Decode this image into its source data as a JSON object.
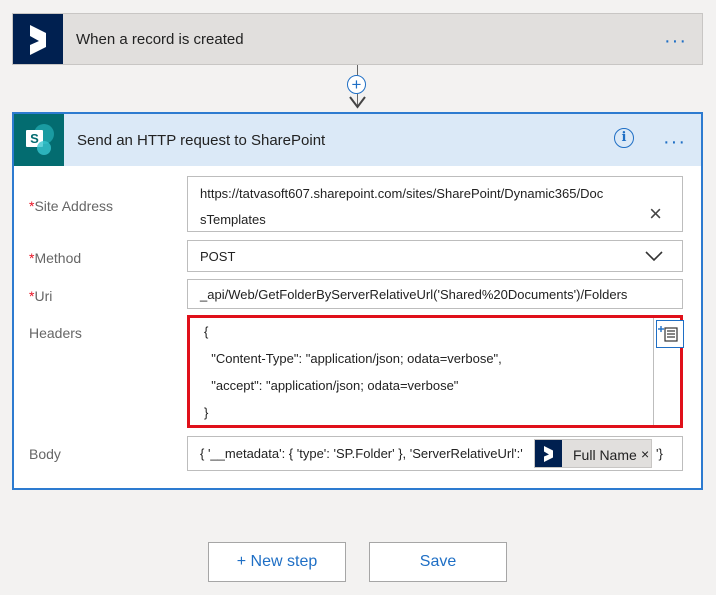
{
  "trigger": {
    "title": "When a record is created",
    "menu": "···"
  },
  "connector": {
    "add_symbol": "+"
  },
  "action": {
    "title": "Send an HTTP request to SharePoint",
    "info_symbol": "i",
    "menu": "···",
    "required_marker": "*",
    "fields": {
      "site_address": {
        "label": "Site Address",
        "value_line1": "https://tatvasoft607.sharepoint.com/sites/SharePoint/Dynamic365/Doc",
        "value_line2": "sTemplates"
      },
      "method": {
        "label": "Method",
        "value": "POST"
      },
      "uri": {
        "label": "Uri",
        "value": "_api/Web/GetFolderByServerRelativeUrl('Shared%20Documents')/Folders"
      },
      "headers": {
        "label": "Headers",
        "lines": [
          "{",
          "  \"Content-Type\": \"application/json; odata=verbose\",",
          "  \"accept\": \"application/json; odata=verbose\"",
          "}"
        ]
      },
      "body": {
        "label": "Body",
        "value": "{ '__metadata': { 'type': 'SP.Folder' }, 'ServerRelativeUrl':'",
        "token_label": "Full Name",
        "token_remove": "×",
        "suffix": "'}"
      }
    }
  },
  "footer": {
    "new_step": "+ New step",
    "save": "Save"
  },
  "colors": {
    "accent": "#1f6fc5",
    "highlight": "#e0101a",
    "dynamics": "#002050",
    "sharepoint": "#036c70"
  }
}
